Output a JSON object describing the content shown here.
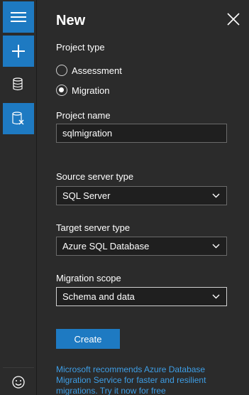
{
  "panel": {
    "title": "New",
    "project_type_label": "Project type",
    "radio_assessment": "Assessment",
    "radio_migration": "Migration",
    "selected_project_type": "Migration",
    "project_name_label": "Project name",
    "project_name_value": "sqlmigration",
    "source_label": "Source server type",
    "source_value": "SQL Server",
    "target_label": "Target server type",
    "target_value": "Azure SQL Database",
    "scope_label": "Migration scope",
    "scope_value": "Schema and data",
    "create_button": "Create",
    "info_text": "Microsoft recommends Azure Database Migration Service for faster and resilient migrations. Try it now for free"
  },
  "rail": {
    "items": [
      "hamburger-menu-icon",
      "plus-icon",
      "database-icon",
      "database-delete-icon",
      "smiley-icon"
    ]
  },
  "colors": {
    "accent": "#1e7ac2",
    "background": "#2b2b2b",
    "link": "#3e9ee6"
  }
}
